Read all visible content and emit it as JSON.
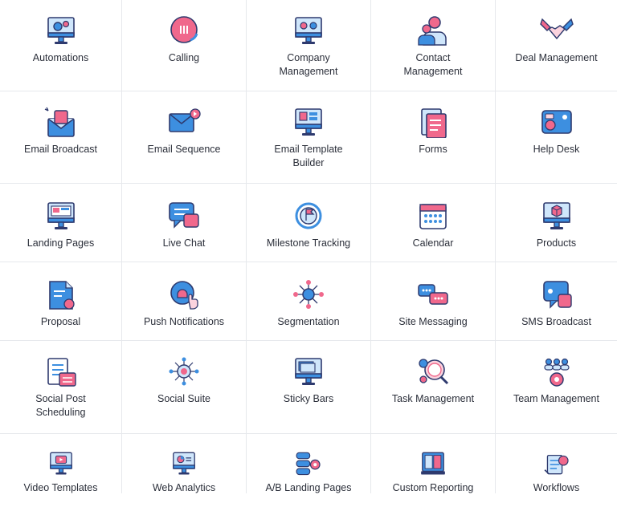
{
  "colors": {
    "navy": "#2e3a6e",
    "blue": "#3d8fe0",
    "pink": "#f0688c",
    "light_blue": "#cfe6fb",
    "light_pink": "#fbd3de",
    "divider": "#e6e8ec"
  },
  "features": [
    {
      "label": "Automations",
      "icon": "automations-icon"
    },
    {
      "label": "Calling",
      "icon": "phone-icon"
    },
    {
      "label": "Company\nManagement",
      "icon": "company-management-icon"
    },
    {
      "label": "Contact\nManagement",
      "icon": "contacts-icon"
    },
    {
      "label": "Deal Management",
      "icon": "handshake-icon"
    },
    {
      "label": "Email Broadcast",
      "icon": "email-broadcast-icon"
    },
    {
      "label": "Email Sequence",
      "icon": "email-sequence-icon"
    },
    {
      "label": "Email Template\nBuilder",
      "icon": "email-template-icon"
    },
    {
      "label": "Forms",
      "icon": "forms-icon"
    },
    {
      "label": "Help Desk",
      "icon": "help-desk-icon"
    },
    {
      "label": "Landing Pages",
      "icon": "landing-pages-icon"
    },
    {
      "label": "Live Chat",
      "icon": "live-chat-icon"
    },
    {
      "label": "Milestone Tracking",
      "icon": "milestone-icon"
    },
    {
      "label": "Calendar",
      "icon": "calendar-icon"
    },
    {
      "label": "Products",
      "icon": "products-icon"
    },
    {
      "label": "Proposal",
      "icon": "proposal-icon"
    },
    {
      "label": "Push Notifications",
      "icon": "push-notification-icon"
    },
    {
      "label": "Segmentation",
      "icon": "segmentation-icon"
    },
    {
      "label": "Site Messaging",
      "icon": "site-messaging-icon"
    },
    {
      "label": "SMS Broadcast",
      "icon": "sms-broadcast-icon"
    },
    {
      "label": "Social Post\nScheduling",
      "icon": "social-scheduling-icon"
    },
    {
      "label": "Social Suite",
      "icon": "social-suite-icon"
    },
    {
      "label": "Sticky Bars",
      "icon": "sticky-bars-icon"
    },
    {
      "label": "Task Management",
      "icon": "task-management-icon"
    },
    {
      "label": "Team Management",
      "icon": "team-management-icon"
    },
    {
      "label": "Video Templates",
      "icon": "video-templates-icon"
    },
    {
      "label": "Web Analytics",
      "icon": "web-analytics-icon"
    },
    {
      "label": "A/B Landing Pages",
      "icon": "ab-testing-icon"
    },
    {
      "label": "Custom Reporting",
      "icon": "reporting-icon"
    },
    {
      "label": "Workflows",
      "icon": "workflows-icon"
    }
  ]
}
